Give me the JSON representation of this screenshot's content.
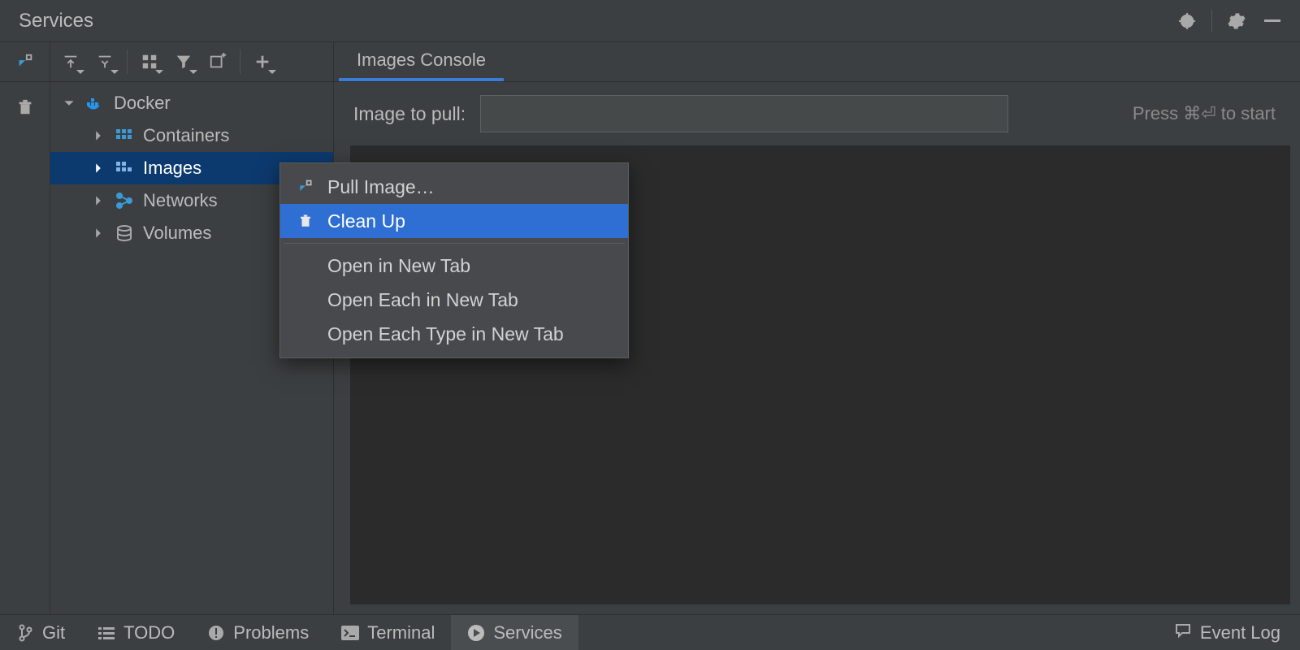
{
  "title": "Services",
  "toolbar_icons": {
    "collapse_in": "collapse-in",
    "expand_all": "expand-all",
    "collapse_all": "collapse-all",
    "grid": "grid",
    "filter": "filter",
    "window_new": "new-window",
    "plus": "add"
  },
  "tab": {
    "label": "Images Console"
  },
  "tree": {
    "root": {
      "label": "Docker"
    },
    "children": [
      {
        "label": "Containers"
      },
      {
        "label": "Images"
      },
      {
        "label": "Networks"
      },
      {
        "label": "Volumes"
      }
    ]
  },
  "pull": {
    "label": "Image to pull:",
    "value": "",
    "hint": "Press ⌘⏎ to start"
  },
  "context_menu": {
    "pull_image": "Pull Image…",
    "clean_up": "Clean Up",
    "open_new_tab": "Open in New Tab",
    "open_each_new_tab": "Open Each in New Tab",
    "open_each_type_new_tab": "Open Each Type in New Tab"
  },
  "status": {
    "git": "Git",
    "todo": "TODO",
    "problems": "Problems",
    "terminal": "Terminal",
    "services": "Services",
    "event_log": "Event Log"
  }
}
